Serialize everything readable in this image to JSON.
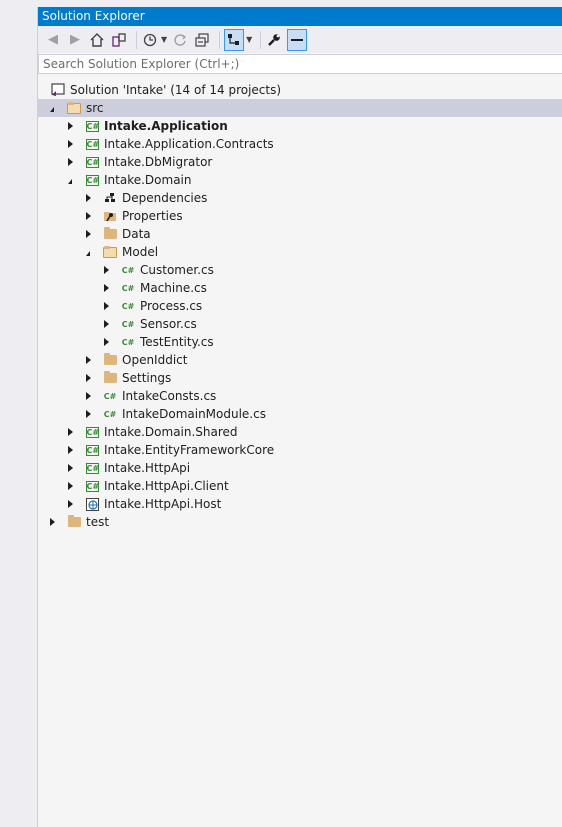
{
  "window": {
    "title": "Solution Explorer"
  },
  "search": {
    "placeholder": "Search Solution Explorer (Ctrl+;)"
  },
  "solution": {
    "label": "Solution 'Intake' (14 of 14 projects)"
  },
  "tree": {
    "src": "src",
    "intake_application": "Intake.Application",
    "intake_application_contracts": "Intake.Application.Contracts",
    "intake_dbmigrator": "Intake.DbMigrator",
    "intake_domain": "Intake.Domain",
    "dependencies": "Dependencies",
    "properties": "Properties",
    "data": "Data",
    "model": "Model",
    "customer": "Customer.cs",
    "machine": "Machine.cs",
    "process": "Process.cs",
    "sensor": "Sensor.cs",
    "testentity": "TestEntity.cs",
    "openiddict": "OpenIddict",
    "settings": "Settings",
    "intakeconsts": "IntakeConsts.cs",
    "intakedomainmodule": "IntakeDomainModule.cs",
    "intake_domain_shared": "Intake.Domain.Shared",
    "intake_efcore": "Intake.EntityFrameworkCore",
    "intake_httpapi": "Intake.HttpApi",
    "intake_httpapi_client": "Intake.HttpApi.Client",
    "intake_httpapi_host": "Intake.HttpApi.Host",
    "test": "test"
  },
  "icons": {
    "csharp_project": "C#",
    "csharp_file": "C#"
  },
  "colors": {
    "accent": "#007acc",
    "selection": "#cccedb",
    "csharp": "#388a34",
    "folder": "#dcb67a"
  }
}
